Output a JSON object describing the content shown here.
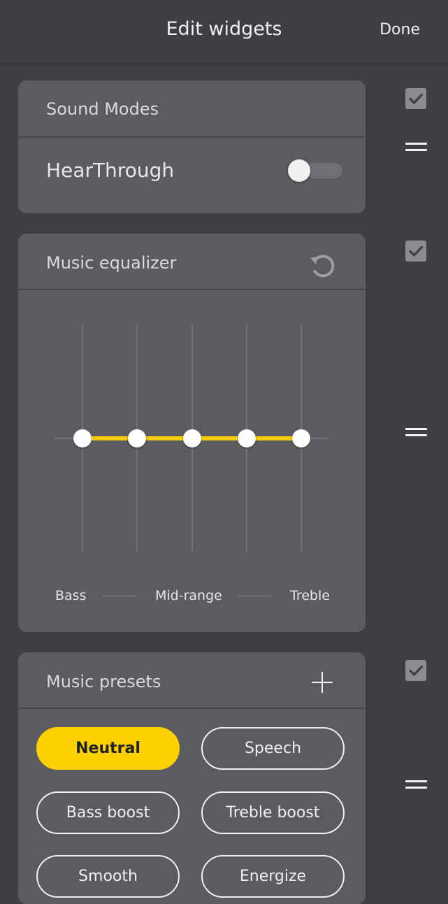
{
  "header": {
    "title": "Edit widgets",
    "done_label": "Done"
  },
  "sound_modes": {
    "title": "Sound Modes",
    "hearthrough_label": "HearThrough",
    "hearthrough_on": false,
    "visible_checked": true
  },
  "equalizer": {
    "title": "Music equalizer",
    "visible_checked": true,
    "labels": {
      "bass": "Bass",
      "mid": "Mid-range",
      "treble": "Treble"
    },
    "bands": [
      0,
      0,
      0,
      0,
      0
    ],
    "accent_color": "#f8cb00"
  },
  "presets": {
    "title": "Music presets",
    "visible_checked": true,
    "items": [
      {
        "label": "Neutral",
        "active": true
      },
      {
        "label": "Speech",
        "active": false
      },
      {
        "label": "Bass boost",
        "active": false
      },
      {
        "label": "Treble boost",
        "active": false
      },
      {
        "label": "Smooth",
        "active": false
      },
      {
        "label": "Energize",
        "active": false
      }
    ],
    "accent_color": "#fdd000"
  }
}
